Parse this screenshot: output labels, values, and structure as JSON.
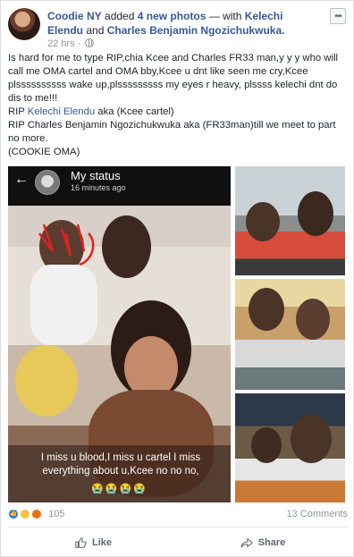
{
  "post": {
    "author": "Coodie NY",
    "action_text": "added",
    "photo_count_text": "4 new photos",
    "with_text": "— with",
    "tagged_1": "Kelechi Elendu",
    "and_text": "and",
    "tagged_2": "Charles Benjamin Ngozichukwuka.",
    "time": "22 hrs",
    "more_label": "•••",
    "text": {
      "line1": "Is hard for me to type RIP,chia Kcee and Charles FR33 man,y y y who will call me OMA cartel and OMA bby,Kcee u dnt like seen me cry,Kcee plssssssssss wake up,plsssssssss my eyes r heavy, plssss kelechi dnt do dis to me!!!",
      "rip_prefix": "RIP",
      "rip_name": "Kelechi Elendu",
      "rip_suffix": "aka (Kcee cartel)",
      "line3": "RIP Charles Benjamin Ngozichukwuka aka (FR33man)till we meet to part no more.",
      "line4": "(COOKIE OMA)"
    }
  },
  "status_screen": {
    "back_icon": "back-arrow-icon",
    "title": "My status",
    "time": "16 minutes ago",
    "caption": "I miss u blood,I miss u cartel I miss everything about u,Kcee no no no,",
    "emojis": "😭😭😭😭"
  },
  "reactions": {
    "count": "105",
    "comments": "13 Comments",
    "icons": [
      "like-reaction-icon",
      "sad-reaction-icon",
      "angry-reaction-icon"
    ]
  },
  "actions": {
    "like": "Like",
    "share": "Share"
  },
  "colors": {
    "link": "#365899",
    "meta": "#90949c",
    "action": "#606770",
    "like_blue": "#2078f4"
  }
}
